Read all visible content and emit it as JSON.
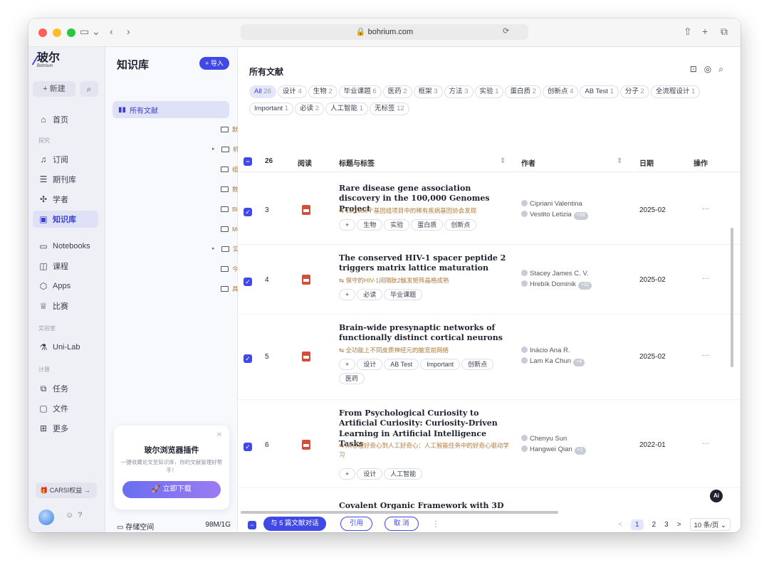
{
  "browser": {
    "url": "bohrium.com",
    "lock": "🔒"
  },
  "logo": {
    "zh": "玻尔",
    "en": "Bohrium"
  },
  "appbar": {
    "new_label": "+ 新建",
    "items": [
      {
        "label": "首页"
      },
      {
        "label": "订阅"
      },
      {
        "label": "期刊库"
      },
      {
        "label": "学者"
      },
      {
        "label": "知识库"
      },
      {
        "label": "Notebooks"
      },
      {
        "label": "课程"
      },
      {
        "label": "Apps"
      },
      {
        "label": "比赛"
      },
      {
        "label": "Uni-Lab"
      },
      {
        "label": "任务"
      },
      {
        "label": "文件"
      },
      {
        "label": "更多"
      }
    ],
    "sections": [
      "探究",
      "实验室",
      "计算"
    ],
    "cars_label": "CARSI权益 →"
  },
  "kpanel": {
    "title": "知识库",
    "import_label": "+ 导入",
    "items": [
      {
        "label": "所有文献"
      },
      {
        "label": "默认文件夹"
      },
      {
        "label": "机器学习"
      },
      {
        "label": "组合分享"
      },
      {
        "label": "数据清洗"
      },
      {
        "label": "Biomass"
      },
      {
        "label": "Molecule"
      },
      {
        "label": "实验设计"
      },
      {
        "label": "今日必读"
      },
      {
        "label": "具身智能"
      }
    ],
    "promo": {
      "title": "玻尔浏览器插件",
      "desc": "一键收藏论文至知识库，你的文献管理好帮手！",
      "button": "🚀 立即下载"
    },
    "storage_label": "存储空间",
    "storage_value": "98M/1G"
  },
  "main": {
    "title": "所有文献",
    "tags": [
      {
        "label": "All",
        "count": "26"
      },
      {
        "label": "设计",
        "count": "4"
      },
      {
        "label": "生物",
        "count": "2"
      },
      {
        "label": "毕业课题",
        "count": "6"
      },
      {
        "label": "医药",
        "count": "2"
      },
      {
        "label": "框架",
        "count": "3"
      },
      {
        "label": "方法",
        "count": "3"
      },
      {
        "label": "实验",
        "count": "1"
      },
      {
        "label": "蛋白质",
        "count": "2"
      },
      {
        "label": "创新点",
        "count": "4"
      },
      {
        "label": "AB Test",
        "count": "1"
      },
      {
        "label": "分子",
        "count": "2"
      },
      {
        "label": "全流程设计",
        "count": "1"
      },
      {
        "label": "Important",
        "count": "1"
      },
      {
        "label": "必读",
        "count": "2"
      },
      {
        "label": "人工智能",
        "count": "1"
      },
      {
        "label": "无标签",
        "count": "12"
      }
    ],
    "header": {
      "count": "26",
      "read": "阅读",
      "title_tags": "标题与标签",
      "author": "作者",
      "date": "日期",
      "ops": "操作"
    },
    "rows": [
      {
        "num": "3",
        "title": "Rare disease gene association discovery in the 100,000 Genomes Project",
        "subtitle": "⇆ 100,000个基因组项目中的稀有疾病基因协会发现",
        "chips": [
          "+",
          "生物",
          "实验",
          "蛋白质",
          "创新点"
        ],
        "author1": "Cipriani Valentina",
        "author2": "Vestito Letizia",
        "badge": "+59",
        "date": "2025-02",
        "ops": "···"
      },
      {
        "num": "4",
        "title": "The conserved HIV-1 spacer peptide 2 triggers matrix lattice maturation",
        "subtitle": "⇆ 保守的HIV-1间隔肽2触发矩阵晶格成熟",
        "chips": [
          "+",
          "必读",
          "毕业课题"
        ],
        "author1": "Stacey James C. V.",
        "author2": "Hrebík Dominik",
        "badge": "+11",
        "date": "2025-02",
        "ops": "···"
      },
      {
        "num": "5",
        "title": "Brain-wide presynaptic networks of functionally distinct cortical neurons",
        "subtitle": "⇆ 全功能上不同皮质神经元的脑宽前网络",
        "chips": [
          "+",
          "设计",
          "AB Test",
          "Important",
          "创新点",
          "医药"
        ],
        "author1": "Inácio Ana R.",
        "author2": "Lam Ka Chun",
        "badge": "+4",
        "date": "2025-02",
        "ops": "···"
      },
      {
        "num": "6",
        "title": "From Psychological Curiosity to Artificial Curiosity: Curiosity-Driven Learning in Artificial Intelligence Tasks",
        "subtitle": "⇆ 从心理好奇心到人工好奇心：人工智能任务中的好奇心驱动学习",
        "chips": [
          "+",
          "设计",
          "人工智能"
        ],
        "author1": "Chenyu Sun",
        "author2": "Hangwei Qian",
        "badge": "+1",
        "date": "2022-01",
        "ops": "···"
      }
    ],
    "partial_title": "Covalent Organic Framework with 3D",
    "footer": {
      "chat": "与 5 篇文献对话",
      "cite": "引用",
      "cancel": "取 消",
      "more": "⋮",
      "prev": "<",
      "pages": [
        "1",
        "2",
        "3"
      ],
      "next": ">",
      "per_page": "10 条/页 ⌄"
    },
    "ai_label": "Ai"
  }
}
